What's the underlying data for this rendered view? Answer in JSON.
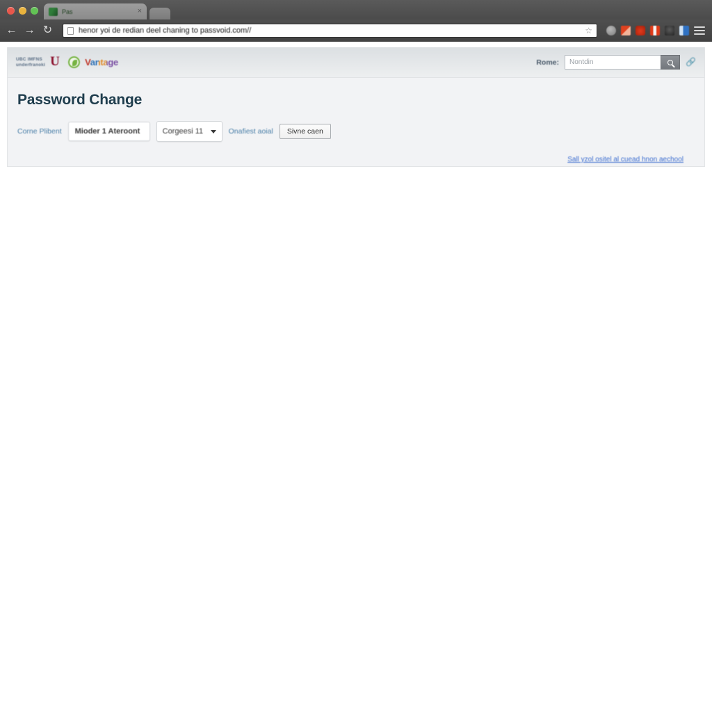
{
  "browser": {
    "tab": {
      "title": "Pas",
      "favicon": "leaf-favicon",
      "close_label": "×"
    },
    "new_tab_label": "",
    "nav": {
      "back": "←",
      "forward": "→",
      "reload": "↻"
    },
    "url": "henor yoi de redian deel chaning to passvoid.com//",
    "star": "☆",
    "extensions": [
      "globe-icon",
      "extension-icon-1",
      "extension-icon-2",
      "extension-icon-3",
      "extension-icon-4",
      "extension-icon-5"
    ],
    "menu": "hamburger-menu-icon"
  },
  "app_header": {
    "brand": {
      "wordmark": "UBC  IMFNS\nunderfranoki",
      "letter_u": "U",
      "leaf": "leaf-logo",
      "vantage": "Vantage"
    },
    "search": {
      "label": "Rome:",
      "placeholder": "Nontdin",
      "value": "",
      "button_icon": "search-icon",
      "link_icon": "link-icon"
    }
  },
  "main": {
    "title": "Password Change",
    "form": {
      "field_label": "Corne Plibent",
      "text_value": "Mioder 1 Ateroont",
      "select_value": "Corgeesi 11",
      "select_caret": "chevron-down-icon",
      "inline_link": "Onafiest aoial",
      "save_label": "Sivne caen"
    },
    "bottom_link": "Sall yzol ositel al cuead hnon aechool"
  },
  "colors": {
    "title": "#1f3d4d",
    "link": "#4a7fa8",
    "bottom_link": "#3f6fd0",
    "panel_bg": "#f2f3f5",
    "header_top": "#dbdfe2",
    "header_bottom": "#edeff0"
  }
}
